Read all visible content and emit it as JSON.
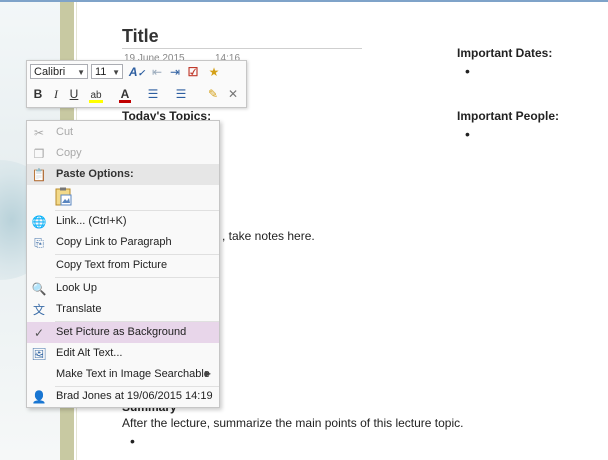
{
  "note": {
    "title": "Title",
    "date": "19 June 2015",
    "time": "14:16",
    "topics_heading": "Today's Topics:",
    "notes_text": ", take notes here.",
    "summary_heading": "Summary",
    "summary_text": "After the lecture, summarize the main points of this lecture topic.",
    "bullet": "•",
    "important_dates": "Important Dates:",
    "important_people": "Important People:"
  },
  "mini_toolbar": {
    "font_name": "Calibri",
    "font_size": "11",
    "icons": [
      "styles-icon",
      "decrease-indent-icon",
      "increase-indent-icon",
      "todo-tag-icon",
      "tag-star-icon",
      "bold-icon",
      "italic-icon",
      "underline-icon",
      "highlight-icon",
      "font-color-icon",
      "bullets-icon",
      "numbering-icon",
      "format-painter-icon",
      "clear-formatting-icon"
    ],
    "bold": "B",
    "italic": "I",
    "underline": "U"
  },
  "context_menu": {
    "items": [
      {
        "label": "Cut",
        "icon": "scissors-icon",
        "enabled": false
      },
      {
        "label": "Copy",
        "icon": "copy-icon",
        "enabled": false
      },
      {
        "label": "Paste Options:",
        "icon": "paste-icon",
        "header": true
      },
      {
        "label": "Link...  (Ctrl+K)",
        "icon": "link-icon",
        "enabled": true
      },
      {
        "label": "Copy Link to Paragraph",
        "icon": "paragraph-link-icon",
        "enabled": true
      },
      {
        "label": "Copy Text from Picture",
        "icon": "",
        "enabled": true
      },
      {
        "label": "Look Up",
        "icon": "lookup-icon",
        "enabled": true
      },
      {
        "label": "Translate",
        "icon": "translate-icon",
        "enabled": true
      },
      {
        "label": "Set Picture as Background",
        "icon": "checkmark-icon",
        "enabled": true,
        "highlighted": true
      },
      {
        "label": "Edit Alt Text...",
        "icon": "alt-text-icon",
        "enabled": true
      },
      {
        "label": "Make Text in Image Searchable",
        "icon": "",
        "enabled": true,
        "submenu": true
      },
      {
        "label": "Brad Jones at 19/06/2015 14:19",
        "icon": "person-icon",
        "enabled": true
      }
    ]
  },
  "colors": {
    "highlight": "#e8d6ea",
    "accent_blue": "#3d6ea8",
    "font_color_bar": "#c00000",
    "highlight_bar": "#ffff00"
  }
}
